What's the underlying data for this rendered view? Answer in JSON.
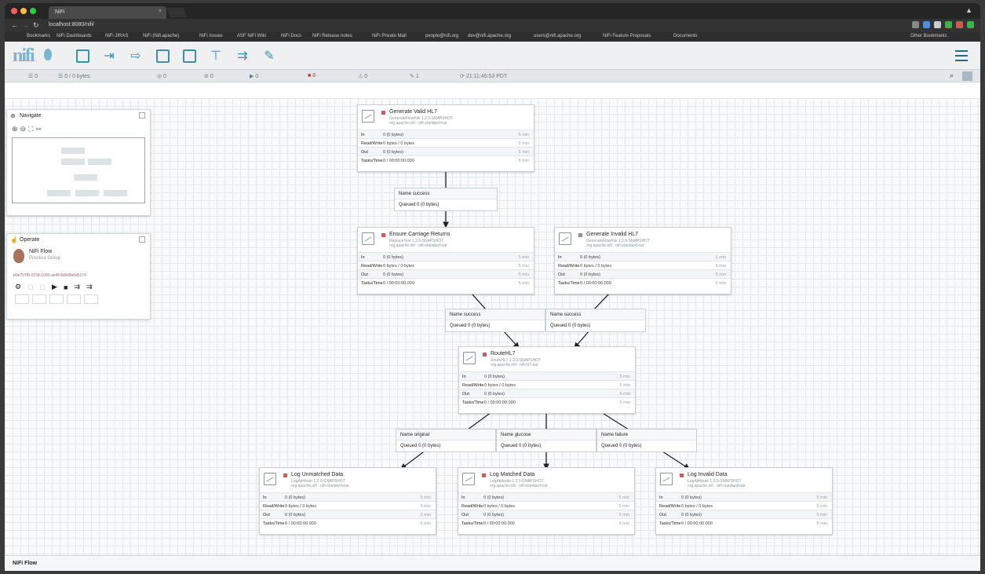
{
  "browser": {
    "tab_title": "NiFi",
    "url": "localhost:8080/nifi/",
    "bookmarks": [
      "Bookmarks",
      "NiFi Dashboards",
      "NiFi JIRAS",
      "NiFi (Nifi.apache)",
      "NiFi Issues",
      "ASF NiFi Wiki",
      "NiFi Docs",
      "NiFi Release notes",
      "NiFi Private Mail",
      "people@nifi.org",
      "dev@nifi.apache.org",
      "users@nifi.apache.org",
      "NiFi Feature Proposals",
      "Documents",
      "Other Bookmarks"
    ]
  },
  "status": {
    "threads": "0",
    "queued": "0 / 0 bytes",
    "groups": "0",
    "transmit": "0",
    "not_transmit": "0",
    "running": "0",
    "stopped": "8",
    "invalid": "0",
    "disabled": "1",
    "refreshed": "21:11:45:53 PDT"
  },
  "navigate": {
    "title": "Navigate"
  },
  "operate": {
    "title": "Operate",
    "flow_name": "NiFi Flow",
    "flow_type": "Process Group",
    "flow_id": "b0e707f8-0158-1000-ae4f-0d9d9b0d5174"
  },
  "processors": [
    {
      "name": "Generate Valid HL7",
      "type": "GenerateFlowFile 1.2.0-SNAPSHOT",
      "bundle": "org.apache.nifi - nifi-standard-nar",
      "in": "0 (0 bytes)",
      "rw": "0 bytes / 0 bytes",
      "out": "0 (0 bytes)",
      "tasks": "0 / 00:00:00.000",
      "window": "5 min"
    },
    {
      "name": "Ensure Carriage Returns",
      "type": "ReplaceText 1.2.0-SNAPSHOT",
      "bundle": "org.apache.nifi - nifi-standard-nar",
      "in": "0 (0 bytes)",
      "rw": "0 bytes / 0 bytes",
      "out": "0 (0 bytes)",
      "tasks": "0 / 00:00:00.000",
      "window": "5 min"
    },
    {
      "name": "Generate Invalid HL7",
      "type": "GenerateFlowFile 1.2.0-SNAPSHOT",
      "bundle": "org.apache.nifi - nifi-standard-nar",
      "in": "0 (0 bytes)",
      "rw": "0 bytes / 0 bytes",
      "out": "0 (0 bytes)",
      "tasks": "0 / 00:00:00.000",
      "window": "5 min"
    },
    {
      "name": "RouteHL7",
      "type": "RouteHL7 1.2.0-SNAPSHOT",
      "bundle": "org.apache.nifi - nifi-hl7-nar",
      "in": "0 (0 bytes)",
      "rw": "0 bytes / 0 bytes",
      "out": "0 (0 bytes)",
      "tasks": "0 / 00:00:00.000",
      "window": "5 min"
    },
    {
      "name": "Log Unmatched Data",
      "type": "LogAttribute 1.2.0-SNAPSHOT",
      "bundle": "org.apache.nifi - nifi-standard-nar",
      "in": "0 (0 bytes)",
      "rw": "0 bytes / 0 bytes",
      "out": "0 (0 bytes)",
      "tasks": "0 / 00:00:00.000",
      "window": "5 min"
    },
    {
      "name": "Log Matched Data",
      "type": "LogAttribute 1.2.0-SNAPSHOT",
      "bundle": "org.apache.nifi - nifi-standard-nar",
      "in": "0 (0 bytes)",
      "rw": "0 bytes / 0 bytes",
      "out": "0 (0 bytes)",
      "tasks": "0 / 00:00:00.000",
      "window": "5 min"
    },
    {
      "name": "Log Invalid Data",
      "type": "LogAttribute 1.2.0-SNAPSHOT",
      "bundle": "org.apache.nifi - nifi-standard-nar",
      "in": "0 (0 bytes)",
      "rw": "0 bytes / 0 bytes",
      "out": "0 (0 bytes)",
      "tasks": "0 / 00:00:00.000",
      "window": "5 min"
    }
  ],
  "labels": {
    "in": "In",
    "rw": "Read/Write",
    "out": "Out",
    "tasks": "Tasks/Time",
    "name": "Name",
    "queued": "Queued"
  },
  "connections": [
    {
      "name": "success",
      "queued": "0 (0 bytes)"
    },
    {
      "name": "success",
      "queued": "0 (0 bytes)"
    },
    {
      "name": "success",
      "queued": "0 (0 bytes)"
    },
    {
      "name": "original",
      "queued": "0 (0 bytes)"
    },
    {
      "name": "glucose",
      "queued": "0 (0 bytes)"
    },
    {
      "name": "failure",
      "queued": "0 (0 bytes)"
    }
  ],
  "footer": "NiFi Flow",
  "colors": {
    "accent": "#3d8fb0",
    "stopped": "#d15b5b",
    "grid": "#e4e8ea"
  }
}
